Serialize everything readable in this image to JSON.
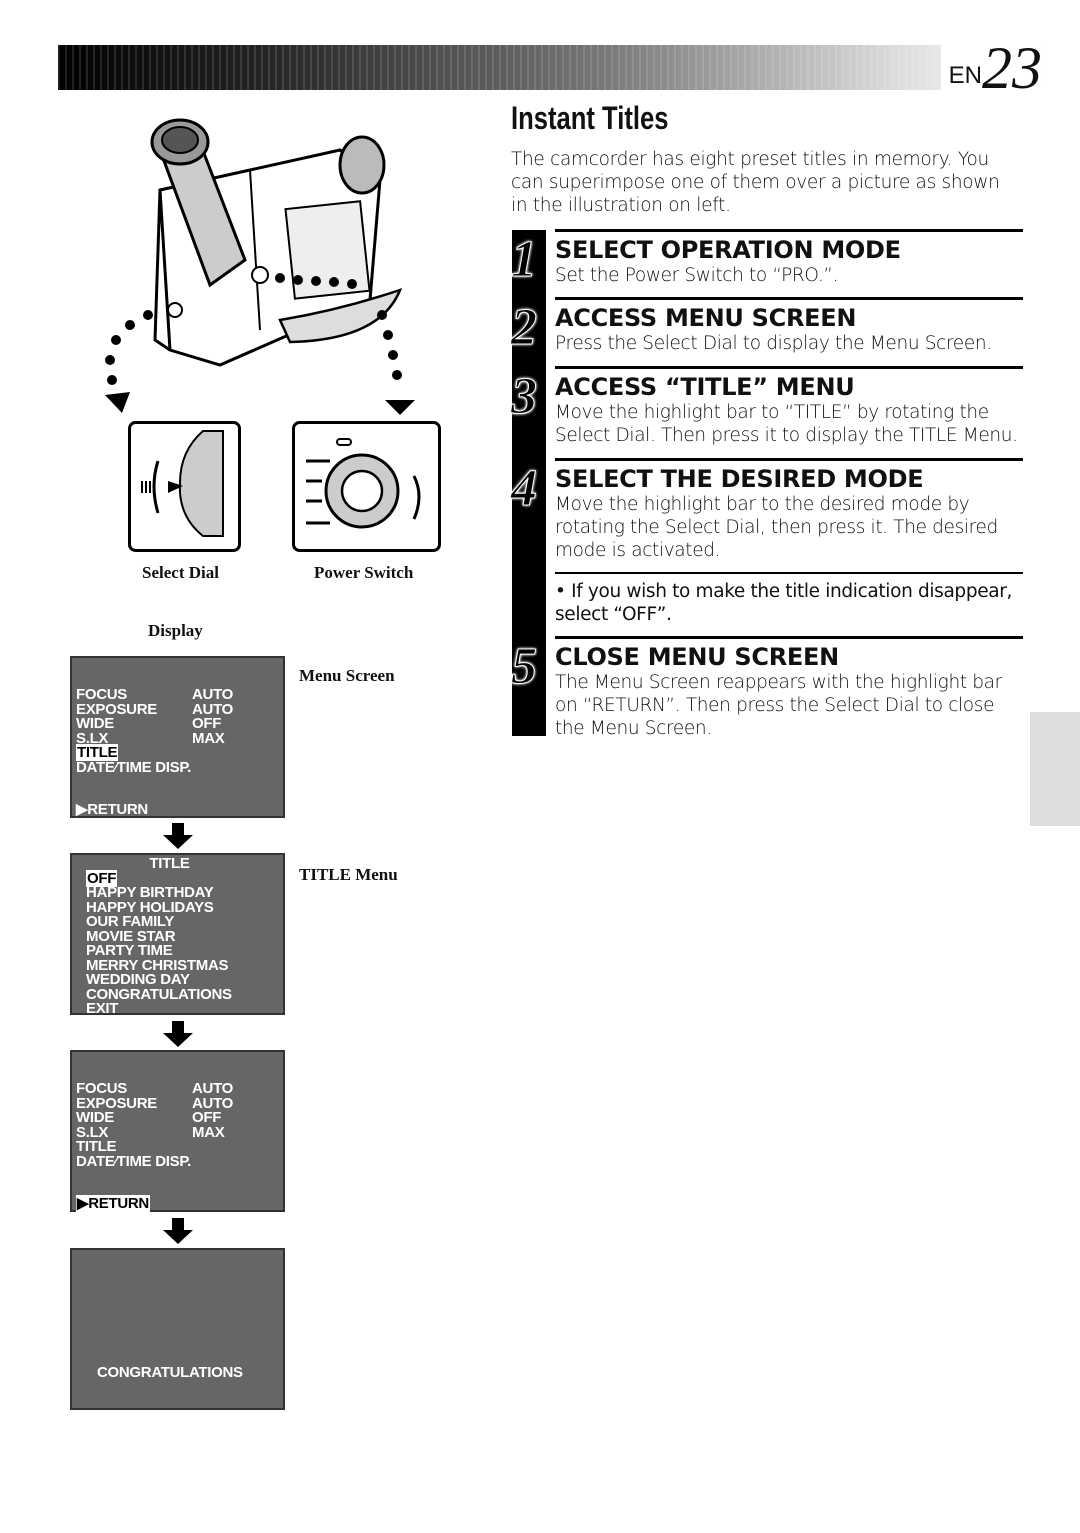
{
  "page": {
    "lang": "EN",
    "number": "23"
  },
  "title": "Instant Titles",
  "intro": "The camcorder has eight preset titles in memory. You can superimpose one of them over a picture as shown in the illustration on left.",
  "steps": [
    {
      "num": "1",
      "heading": "SELECT OPERATION MODE",
      "body": "Set the Power Switch to “PRO.”."
    },
    {
      "num": "2",
      "heading": "ACCESS MENU SCREEN",
      "body": "Press the Select Dial to display the Menu Screen."
    },
    {
      "num": "3",
      "heading": "ACCESS “TITLE” MENU",
      "body": "Move the highlight bar to “TITLE” by rotating the Select Dial. Then press it to display the TITLE Menu."
    },
    {
      "num": "4",
      "heading": "SELECT THE DESIRED MODE",
      "body": "Move the highlight bar to the desired mode by rotating the Select Dial, then press it. The desired mode is activated."
    },
    {
      "num": "5",
      "heading": "CLOSE MENU SCREEN",
      "body": "The Menu Screen reappears with the highlight bar on “RETURN”. Then press the Select Dial to close the Menu Screen."
    }
  ],
  "note": "• If you wish to make the title indication disappear, select “OFF”.",
  "captions": {
    "select_dial": "Select Dial",
    "power_switch": "Power Switch",
    "display": "Display",
    "menu_screen": "Menu Screen",
    "title_menu": "TITLE Menu"
  },
  "menu": {
    "rows": [
      [
        "FOCUS",
        "AUTO"
      ],
      [
        "EXPOSURE",
        "AUTO"
      ],
      [
        "WIDE",
        "OFF"
      ],
      [
        "S.LX",
        "MAX"
      ]
    ],
    "title": "TITLE",
    "date": "DATE⁄TIME DISP.",
    "return": "▶RETURN"
  },
  "title_menu": {
    "header": "TITLE",
    "items": [
      "OFF",
      "HAPPY BIRTHDAY",
      "HAPPY HOLIDAYS",
      "OUR FAMILY",
      "MOVIE STAR",
      "PARTY TIME",
      "MERRY CHRISTMAS",
      "WEDDING DAY",
      "CONGRATULATIONS",
      "EXIT"
    ]
  },
  "display_title": "CONGRATULATIONS"
}
